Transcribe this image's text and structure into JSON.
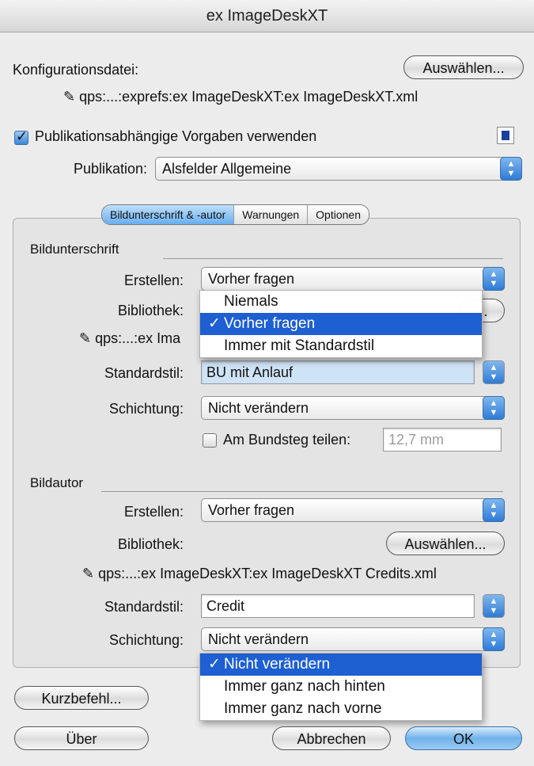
{
  "window": {
    "title": "ex ImageDeskXT"
  },
  "config": {
    "label": "Konfigurationsdatei:",
    "choose_button": "Auswählen...",
    "path": "qps:...:exprefs:ex ImageDeskXT:ex ImageDeskXT.xml"
  },
  "publication": {
    "checkbox_label": "Publikationsabhängige Vorgaben verwenden",
    "checked": true,
    "label": "Publikation:",
    "value": "Alsfelder Allgemeine"
  },
  "tabs": [
    "Bildunterschrift & -autor",
    "Warnungen",
    "Optionen"
  ],
  "caption": {
    "heading": "Bildunterschrift",
    "create_label": "Erstellen:",
    "create_value": "Vorher fragen",
    "library_label": "Bibliothek:",
    "library_button": "...",
    "path_partial": "qps:...:ex Ima",
    "style_label": "Standardstil:",
    "style_value": "BU mit Anlauf",
    "layer_label": "Schichtung:",
    "layer_value": "Nicht verändern",
    "split_label": "Am Bundsteg teilen:",
    "split_value": "12,7 mm",
    "menu": [
      "Niemals",
      "Vorher fragen",
      "Immer mit Standardstil"
    ],
    "menu_selected": "Vorher fragen"
  },
  "author": {
    "heading": "Bildautor",
    "create_label": "Erstellen:",
    "create_value": "Vorher fragen",
    "library_label": "Bibliothek:",
    "library_button": "Auswählen...",
    "path": "qps:...:ex ImageDeskXT:ex ImageDeskXT Credits.xml",
    "style_label": "Standardstil:",
    "style_value": "Credit",
    "layer_label": "Schichtung:",
    "layer_value": "Nicht verändern",
    "menu": [
      "Nicht verändern",
      "Immer ganz nach hinten",
      "Immer ganz nach vorne"
    ],
    "menu_selected": "Nicht verändern"
  },
  "footer": {
    "shortcut_button": "Kurzbefehl...",
    "about_button": "Über",
    "cancel_button": "Abbrechen",
    "ok_button": "OK"
  },
  "checkmark": "✓",
  "accent_color": "#1e5fd1"
}
